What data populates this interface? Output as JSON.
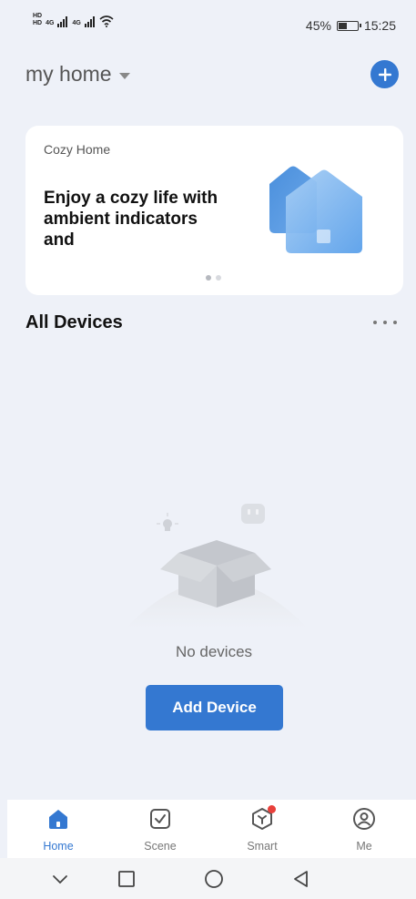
{
  "status_bar": {
    "left_tag_1": "HD",
    "left_tag_2": "HD",
    "net_1": "4G",
    "net_2": "4G",
    "battery_percent": "45%",
    "battery_level": 0.45,
    "time": "15:25"
  },
  "header": {
    "home_name": "my home"
  },
  "banner": {
    "eyebrow": "Cozy Home",
    "headline": "Enjoy a cozy life with ambient indicators and",
    "pages": 2,
    "active_page": 1
  },
  "devices_section": {
    "title": "All Devices"
  },
  "empty_state": {
    "message": "No devices",
    "button_label": "Add Device"
  },
  "tabs": [
    {
      "label": "Home",
      "icon": "home-icon",
      "active": true
    },
    {
      "label": "Scene",
      "icon": "checkbox-icon",
      "active": false
    },
    {
      "label": "Smart",
      "icon": "smart-cube-icon",
      "active": false,
      "badge": true
    },
    {
      "label": "Me",
      "icon": "profile-icon",
      "active": false
    }
  ],
  "colors": {
    "accent": "#3478d1",
    "background": "#eef1f8",
    "badge": "#e8403b"
  }
}
